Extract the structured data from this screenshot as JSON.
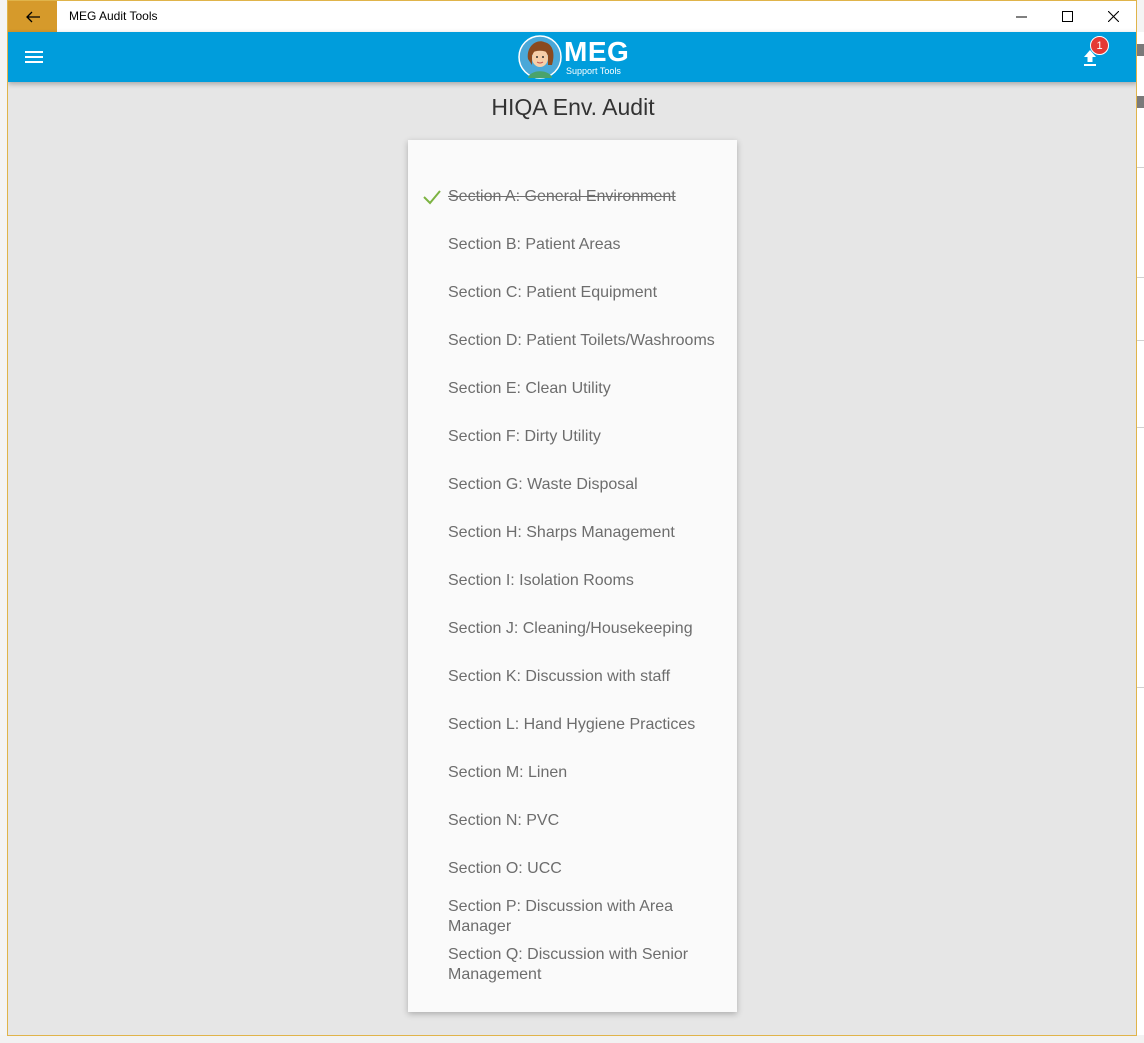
{
  "window": {
    "title": "MEG Audit Tools"
  },
  "appbar": {
    "logo_main": "MEG",
    "logo_sub": "Support Tools",
    "upload_badge": "1"
  },
  "page": {
    "title": "HIQA Env. Audit"
  },
  "sections": [
    {
      "label": "Section A: General Environment",
      "completed": true
    },
    {
      "label": "Section B: Patient Areas",
      "completed": false
    },
    {
      "label": "Section C: Patient Equipment",
      "completed": false
    },
    {
      "label": "Section D: Patient Toilets/Washrooms",
      "completed": false
    },
    {
      "label": "Section E: Clean Utility",
      "completed": false
    },
    {
      "label": "Section F: Dirty Utility",
      "completed": false
    },
    {
      "label": "Section G: Waste Disposal",
      "completed": false
    },
    {
      "label": "Section H: Sharps Management",
      "completed": false
    },
    {
      "label": "Section I: Isolation Rooms",
      "completed": false
    },
    {
      "label": "Section J: Cleaning/Housekeeping",
      "completed": false
    },
    {
      "label": "Section K: Discussion with staff",
      "completed": false
    },
    {
      "label": "Section L: Hand Hygiene Practices",
      "completed": false
    },
    {
      "label": "Section M: Linen",
      "completed": false
    },
    {
      "label": "Section N: PVC",
      "completed": false
    },
    {
      "label": "Section O: UCC",
      "completed": false
    },
    {
      "label": "Section P: Discussion with Area Manager",
      "completed": false
    },
    {
      "label": "Section Q: Discussion with Senior Management",
      "completed": false
    }
  ],
  "colors": {
    "appbar": "#009ddc",
    "back_button": "#d69a2b",
    "check": "#7cb342",
    "badge": "#e53935"
  }
}
